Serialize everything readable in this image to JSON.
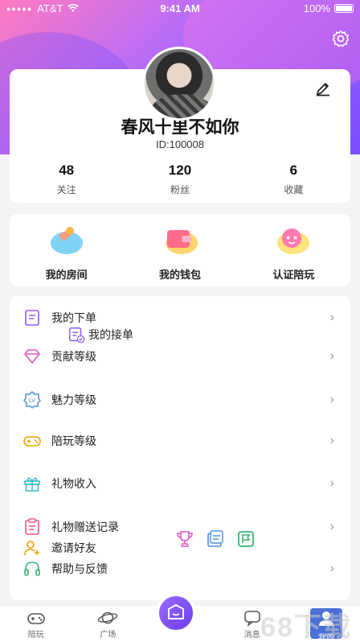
{
  "status": {
    "carrier": "AT&T",
    "time": "9:41 AM",
    "battery": "100%"
  },
  "profile": {
    "nickname": "春风十里不如你",
    "id": "ID:100008",
    "stats": [
      {
        "value": "48",
        "label": "关注"
      },
      {
        "value": "120",
        "label": "粉丝"
      },
      {
        "value": "6",
        "label": "收藏"
      }
    ]
  },
  "quick": [
    {
      "label": "我的房间",
      "icon": "room-icon"
    },
    {
      "label": "我的钱包",
      "icon": "wallet-icon"
    },
    {
      "label": "认证陪玩",
      "icon": "certify-icon"
    }
  ],
  "menu": [
    {
      "label": "我的下单",
      "icon": "order-icon"
    },
    {
      "label": "我的接单",
      "icon": "accept-order-icon"
    },
    {
      "label": "贡献等级",
      "icon": "diamond-icon"
    },
    {
      "label": "魅力等级",
      "icon": "level-badge-icon"
    },
    {
      "label": "陪玩等级",
      "icon": "gamepad-icon"
    },
    {
      "label": "礼物收入",
      "icon": "gift-icon"
    },
    {
      "label": "礼物赠送记录",
      "icon": "gift-record-icon"
    },
    {
      "label": "邀请好友",
      "icon": "invite-icon"
    },
    {
      "label": "帮助与反馈",
      "icon": "headset-icon"
    }
  ],
  "tabs": [
    {
      "label": "陪玩",
      "icon": "gamepad-tab-icon"
    },
    {
      "label": "广场",
      "icon": "planet-icon"
    },
    {
      "label": "",
      "icon": "home-center-icon"
    },
    {
      "label": "消息",
      "icon": "message-icon"
    },
    {
      "label": "我的",
      "icon": "user-icon"
    }
  ],
  "watermark": "68下载",
  "colors": {
    "accent": "#8a5cff",
    "hero_start": "#ff7ac0",
    "hero_end": "#7a4dff"
  }
}
